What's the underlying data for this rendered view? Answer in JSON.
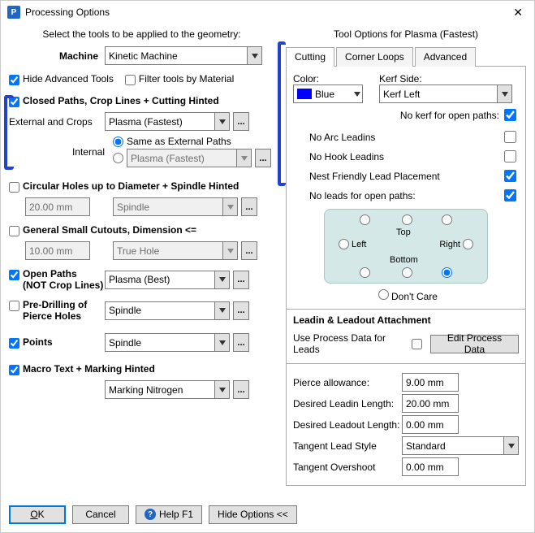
{
  "window": {
    "title": "Processing Options",
    "icon_text": "P"
  },
  "left": {
    "header": "Select the tools to be applied to the geometry:",
    "machine_label": "Machine",
    "machine_value": "Kinetic Machine",
    "hide_advanced": "Hide Advanced Tools",
    "filter_material": "Filter tools by Material",
    "closed_paths": "Closed Paths,  Crop Lines  +  Cutting Hinted",
    "external_label": "External and Crops",
    "external_value": "Plasma (Fastest)",
    "internal_label": "Internal",
    "same_as_external": "Same as External Paths",
    "internal_value": "Plasma (Fastest)",
    "circular_holes": "Circular Holes up to Diameter   +  Spindle Hinted",
    "circular_dim": "20.00 mm",
    "circular_tool": "Spindle",
    "general_small": "General Small Cutouts, Dimension <=",
    "general_dim": "10.00 mm",
    "general_tool": "True Hole",
    "open_paths_l1": "Open Paths",
    "open_paths_l2": "(NOT Crop Lines)",
    "open_tool": "Plasma (Best)",
    "predrill_l1": "Pre-Drilling of",
    "predrill_l2": "Pierce Holes",
    "predrill_tool": "Spindle",
    "points_label": "Points",
    "points_tool": "Spindle",
    "macro_text": "Macro Text   +  Marking Hinted",
    "macro_tool": "Marking Nitrogen"
  },
  "right": {
    "header": "Tool Options for Plasma (Fastest)",
    "tabs": {
      "cutting": "Cutting",
      "corner": "Corner Loops",
      "advanced": "Advanced"
    },
    "color_label": "Color:",
    "color_value": "Blue",
    "kerf_label": "Kerf Side:",
    "kerf_value": "Kerf Left",
    "no_kerf_open": "No kerf for open paths:",
    "no_arc": "No Arc Leadins",
    "no_hook": "No Hook Leadins",
    "nest_friendly": "Nest Friendly Lead Placement",
    "no_leads_open": "No leads for open paths:",
    "pos_top": "Top",
    "pos_bottom": "Bottom",
    "pos_left": "Left",
    "pos_right": "Right",
    "dont_care": "Don't Care",
    "leadin_leadout": "Leadin & Leadout Attachment",
    "use_process": "Use Process Data for Leads",
    "edit_process": "Edit Process Data",
    "pierce_allow": "Pierce allowance:",
    "pierce_val": "9.00 mm",
    "leadin_len": "Desired Leadin Length:",
    "leadin_val": "20.00 mm",
    "leadout_len": "Desired Leadout Length:",
    "leadout_val": "0.00 mm",
    "tangent_style": "Tangent Lead Style",
    "tangent_style_val": "Standard",
    "tangent_over": "Tangent Overshoot",
    "tangent_over_val": "0.00 mm"
  },
  "footer": {
    "ok": "OK",
    "cancel": "Cancel",
    "help": "Help F1",
    "hide_options": "Hide Options <<"
  }
}
